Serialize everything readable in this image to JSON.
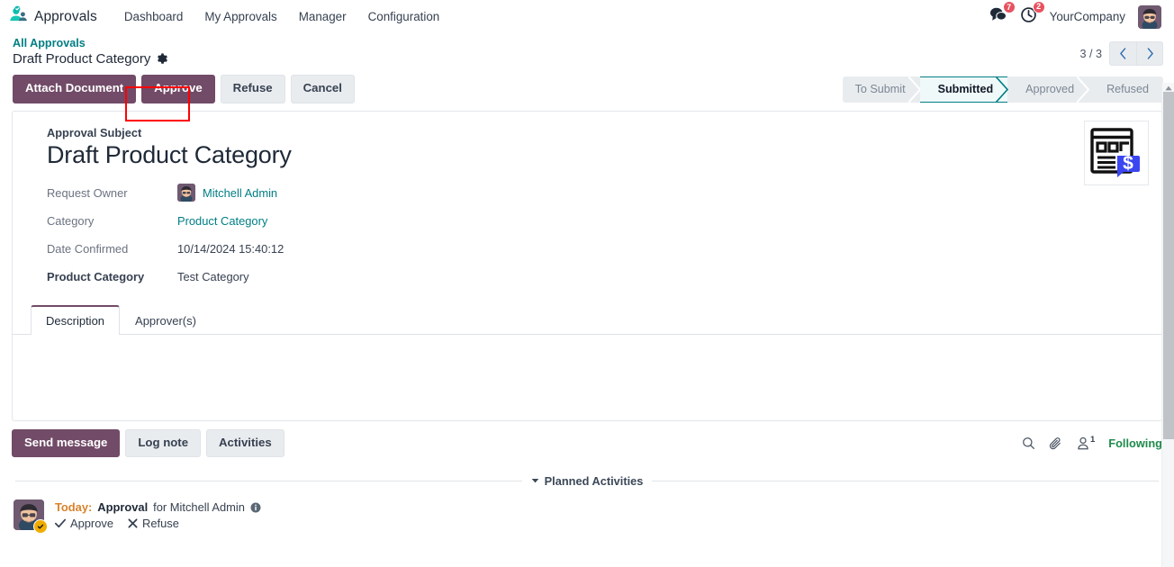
{
  "navbar": {
    "app_name": "Approvals",
    "app_icon": "approvals-people-icon",
    "menu": [
      {
        "label": "Dashboard"
      },
      {
        "label": "My Approvals"
      },
      {
        "label": "Manager"
      },
      {
        "label": "Configuration"
      }
    ],
    "messages_badge": "7",
    "activities_badge": "2",
    "company": "YourCompany"
  },
  "breadcrumb": {
    "parent": "All Approvals",
    "current": "Draft Product Category"
  },
  "pager": {
    "counter": "3 / 3"
  },
  "actions": {
    "attach_document": "Attach Document",
    "approve": "Approve",
    "refuse": "Refuse",
    "cancel": "Cancel"
  },
  "statusbar": {
    "stages": [
      {
        "label": "To Submit",
        "active": false
      },
      {
        "label": "Submitted",
        "active": true
      },
      {
        "label": "Approved",
        "active": false
      },
      {
        "label": "Refused",
        "active": false
      }
    ]
  },
  "form": {
    "subject_label": "Approval Subject",
    "subject": "Draft Product Category",
    "fields": [
      {
        "label": "Request Owner",
        "value": "Mitchell Admin",
        "type": "user-link"
      },
      {
        "label": "Category",
        "value": "Product Category",
        "type": "link"
      },
      {
        "label": "Date Confirmed",
        "value": "10/14/2024 15:40:12",
        "type": "text"
      },
      {
        "label": "Product Category",
        "value": "Test Category",
        "type": "text",
        "bold_label": true
      }
    ],
    "corner_image": "document-dollar-icon"
  },
  "tabs": [
    {
      "label": "Description",
      "active": true
    },
    {
      "label": "Approver(s)",
      "active": false
    }
  ],
  "tab_content": {
    "description": ""
  },
  "chatter": {
    "send_message": "Send message",
    "log_note": "Log note",
    "activities": "Activities",
    "search_icon": "search-icon",
    "attachment_icon": "paperclip-icon",
    "follower_icon": "follower-person-icon",
    "follower_count": "1",
    "following": "Following",
    "planned_activities": "Planned Activities"
  },
  "activity": {
    "today": "Today:",
    "type": "Approval",
    "assignee": "for Mitchell Admin",
    "approve": "Approve",
    "refuse": "Refuse"
  },
  "colors": {
    "primary": "#714B67",
    "accent_teal": "#017e84",
    "badge_red": "#e7525f",
    "following_green": "#1f8b4c",
    "today_orange": "#d9822b",
    "highlight_red": "#ff0000"
  }
}
